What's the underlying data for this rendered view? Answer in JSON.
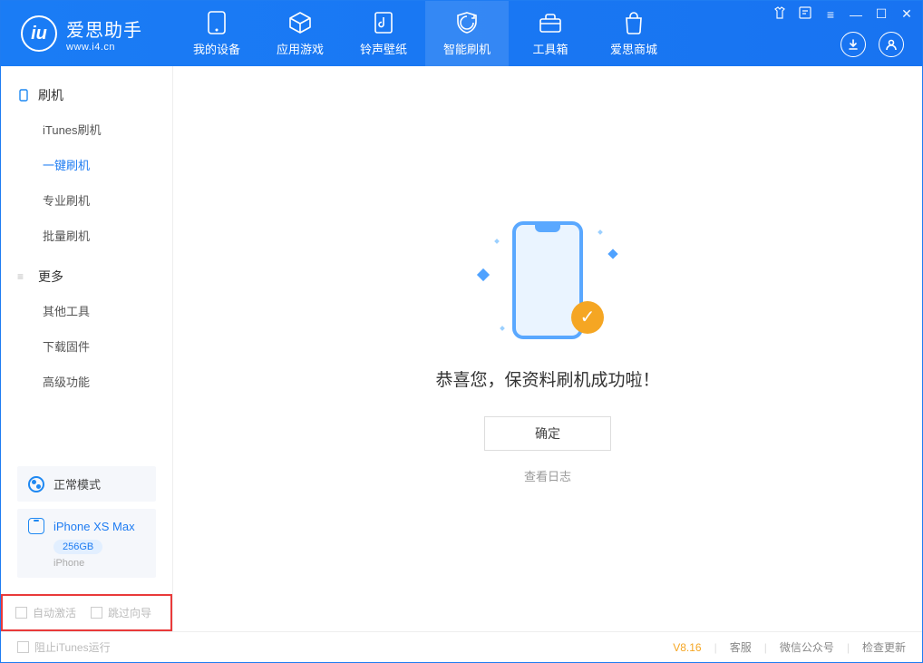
{
  "app": {
    "name_cn": "爱思助手",
    "name_en": "www.i4.cn"
  },
  "nav": {
    "items": [
      {
        "label": "我的设备",
        "icon": "device"
      },
      {
        "label": "应用游戏",
        "icon": "cube"
      },
      {
        "label": "铃声壁纸",
        "icon": "note"
      },
      {
        "label": "智能刷机",
        "icon": "shield"
      },
      {
        "label": "工具箱",
        "icon": "toolbox"
      },
      {
        "label": "爱思商城",
        "icon": "bag"
      }
    ],
    "active_index": 3
  },
  "sidebar": {
    "section1": {
      "title": "刷机",
      "items": [
        "iTunes刷机",
        "一键刷机",
        "专业刷机",
        "批量刷机"
      ],
      "active_index": 1
    },
    "section2": {
      "title": "更多",
      "items": [
        "其他工具",
        "下载固件",
        "高级功能"
      ]
    },
    "mode": {
      "label": "正常模式"
    },
    "device": {
      "name": "iPhone XS Max",
      "capacity": "256GB",
      "sub": "iPhone"
    },
    "options": {
      "auto_activate": "自动激活",
      "skip_guide": "跳过向导"
    }
  },
  "main": {
    "success_msg": "恭喜您，保资料刷机成功啦！",
    "ok_label": "确定",
    "log_link": "查看日志"
  },
  "status": {
    "block_itunes": "阻止iTunes运行",
    "version": "V8.16",
    "links": [
      "客服",
      "微信公众号",
      "检查更新"
    ]
  }
}
